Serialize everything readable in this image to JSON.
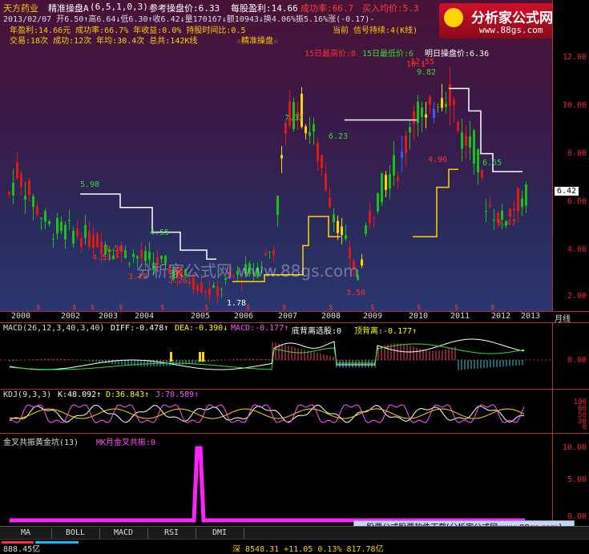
{
  "header": {
    "stock_name": "天方药业",
    "indicator_name": "精准操盘A",
    "indicator_params": "(6,5,1,0,3)",
    "ref_price": "参考操盘价:6.33",
    "profit_per_share": "每股盈利:14.66",
    "success_rate": "成功率:66.7",
    "buy_avg": "买入均价:5.3",
    "line2": "2013/02/07 开6.50↑高6.64↓低6.30↑收6.42↓量170167↓额10943↓换4.06%振5.16%涨(-0.17)-",
    "stats_line1": "年盈利:14.66元 成功率:66.7% 年收益:0.0% 持股时间比:0.5",
    "stats_line2": "交易:18次 成功:12次 年均:30.4次 总共:142K线",
    "stats_tag": "☆精准操盘☆",
    "signal_status": "当前 信号持续:4(K线)",
    "high_15": "15日最高价:8",
    "low_15": "15日最低价:6",
    "tomorrow_price": "明日操盘价:6.36"
  },
  "logo": {
    "name": "分析家公式网",
    "url": "www.88gs.com"
  },
  "watermark": "分析家公式网 www.88gs.com",
  "main_axis": {
    "ticks": [
      "12.00",
      "10.00",
      "8.00",
      "6.00",
      "4.00",
      "2.00"
    ],
    "current": "6.42"
  },
  "years": [
    "2000",
    "2002",
    "2003",
    "2004",
    "2005",
    "2006",
    "2007",
    "2008",
    "2009",
    "2010",
    "2011",
    "2012",
    "2013"
  ],
  "period_label": "月线",
  "price_annotations": [
    "12.55",
    "9.82",
    "5.98",
    "4.53",
    "4.56",
    "3.18",
    "3.26",
    "1.78",
    "3.50",
    "10.1",
    "7.32",
    "6.23",
    "4.55",
    "4.96",
    "6.65",
    "5.47"
  ],
  "macd": {
    "title": "MACD(26,12,3,40,3,40)",
    "diff": "DIFF:-0.478↑",
    "dea": "DEA:-0.390↓",
    "macd_val": "MACD:-0.177↑",
    "bottom_div": "底背离选股:0",
    "top_div": "顶背离:-0.177↑",
    "tick": "0.00"
  },
  "kdj": {
    "title": "KDJ(9,3,3)",
    "k": "K:48.092↑",
    "d": "D:36.843↑",
    "j": "J:70.589↑",
    "ticks": [
      "100",
      "80",
      "50",
      "20",
      "0"
    ]
  },
  "golden": {
    "title": "金叉共振黄金坑(13)",
    "series": "MK月金叉共振:0",
    "ticks": [
      "10.00",
      "5.00",
      "0.00"
    ]
  },
  "tabs": [
    "MA",
    "BOLL",
    "MACD",
    "RSI",
    "DMI"
  ],
  "banner": "股票公式股票软件下载[分析家公式网www.88gs.com]",
  "status": {
    "left": "888.45亿",
    "center": "深 8548.31 +11.05 0.13% 817.78亿"
  },
  "chart_data": {
    "type": "candlestick",
    "note": "Monthly candles 2000-2013 with buy/sell line and sub-indicators",
    "ylim": [
      1.5,
      13
    ],
    "last_close": 6.42,
    "macd_tick": 0,
    "kdj_ticks": [
      100,
      80,
      50,
      20,
      0
    ],
    "golden_ylim": [
      0,
      10
    ],
    "golden_spike": {
      "x": "2005",
      "value": 10
    }
  }
}
